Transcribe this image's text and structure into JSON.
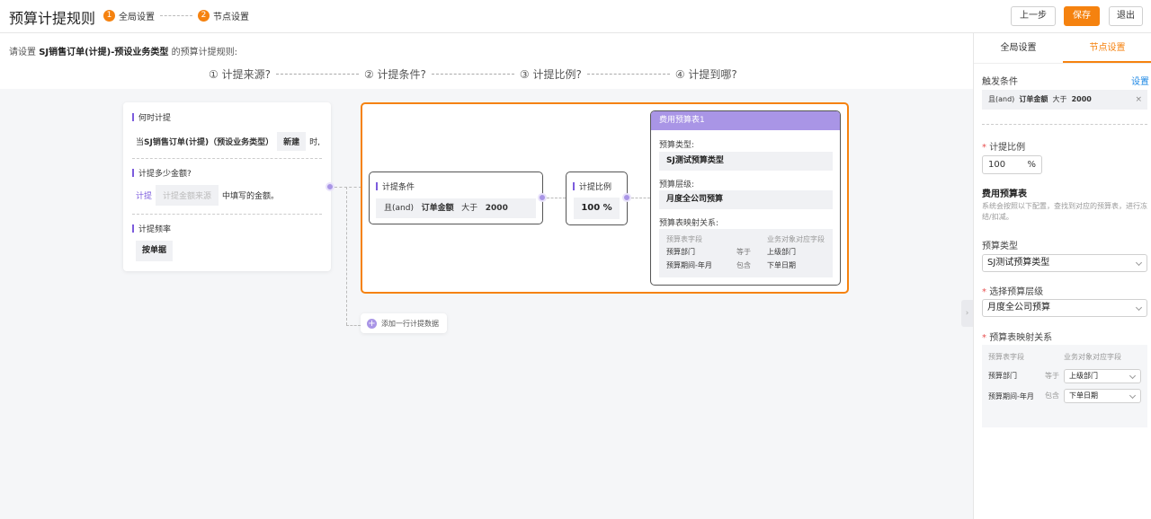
{
  "header": {
    "title": "预算计提规则",
    "steps": [
      {
        "num": "1",
        "label": "全局设置"
      },
      {
        "num": "2",
        "label": "节点设置"
      }
    ],
    "prev_label": "上一步",
    "save_label": "保存",
    "exit_label": "退出"
  },
  "intro": {
    "prefix": "请设置",
    "name": "SJ销售订单(计提)-预设业务类型",
    "suffix": "的预算计提规则:"
  },
  "guide": [
    "① 计提来源?",
    "② 计提条件?",
    "③ 计提比例?",
    "④ 计提到哪?"
  ],
  "source_card": {
    "when_title": "何时计提",
    "when_prefix": "当",
    "when_doc": "SJ销售订单(计提)（预设业务类型）",
    "when_action": "新建",
    "when_suffix": "时,",
    "amount_title": "计提多少金额?",
    "amount_prefix": "计提",
    "amount_placeholder": "计提金额来源",
    "amount_suffix": "中填写的金额。",
    "freq_title": "计提频率",
    "freq_value": "按单据"
  },
  "condition_node": {
    "title": "计提条件",
    "logic": "且(and)",
    "field": "订单金额",
    "op": "大于",
    "value": "2000"
  },
  "ratio_node": {
    "title": "计提比例",
    "value": "100 %"
  },
  "budget_node": {
    "header": "费用预算表1",
    "type_label": "预算类型:",
    "type_value": "SJ测试预算类型",
    "level_label": "预算层级:",
    "level_value": "月度全公司预算",
    "map_label": "预算表映射关系:",
    "map_head_left": "预算表字段",
    "map_head_right": "业务对象对应字段",
    "rows": [
      {
        "field": "预算部门",
        "op": "等于",
        "target": "上级部门"
      },
      {
        "field": "预算期间-年月",
        "op": "包含",
        "target": "下单日期"
      }
    ]
  },
  "add_row_label": "添加一行计提数据",
  "sidebar": {
    "tabs": [
      "全局设置",
      "节点设置"
    ],
    "trigger_label": "触发条件",
    "trigger_link": "设置",
    "trigger": {
      "logic": "且(and)",
      "field": "订单金额",
      "op": "大于",
      "value": "2000"
    },
    "ratio_label": "计提比例",
    "ratio_value": "100",
    "ratio_unit": "%",
    "budget_title": "费用预算表",
    "budget_desc": "系统会按照以下配置，查找到对应的预算表，进行冻结/扣减。",
    "type_label": "预算类型",
    "type_value": "SJ测试预算类型",
    "level_label": "选择预算层级",
    "level_value": "月度全公司预算",
    "map_label": "预算表映射关系",
    "map_head_left": "预算表字段",
    "map_head_right": "业务对象对应字段",
    "rows": [
      {
        "field": "预算部门",
        "op": "等于",
        "target": "上级部门"
      },
      {
        "field": "预算期间-年月",
        "op": "包含",
        "target": "下单日期"
      }
    ]
  },
  "colors": {
    "accent": "#f5820f",
    "purple": "#a995e6",
    "link": "#1e88e5"
  }
}
